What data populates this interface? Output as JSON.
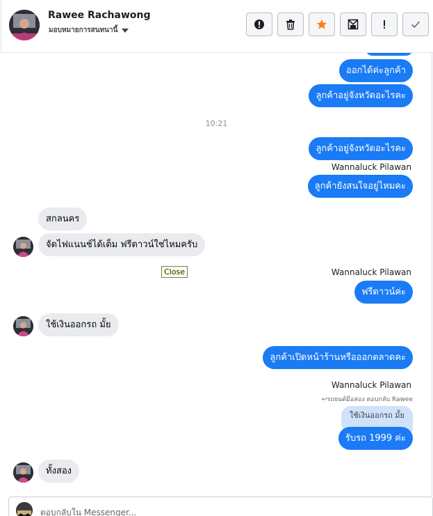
{
  "header": {
    "contact_name": "Rawee Rachawong",
    "page_label": "มอบหมายการสนทนานี้",
    "toolbar": [
      {
        "icon": "alert-circle-icon",
        "name": "mark-spam-button"
      },
      {
        "icon": "trash-icon",
        "name": "delete-button"
      },
      {
        "icon": "star-icon",
        "name": "star-button"
      },
      {
        "icon": "archive-icon",
        "name": "archive-button"
      },
      {
        "icon": "exclamation-icon",
        "name": "flag-button"
      },
      {
        "icon": "check-icon",
        "name": "done-button"
      }
    ],
    "star_color": "#f5821f"
  },
  "chat": {
    "outgoing_color": "#1a7bf4",
    "messages": {
      "m1": "ออกได้ค่ะลูกค้า",
      "m2": "ลูกค้าอยู่จังหวัดอะไรคะ",
      "time1": "10:21",
      "m3": "ลูกค้าอยู่จังหวัดอะไรคะ",
      "sender1": "Wannaluck Pilawan",
      "m4": "ลูกค้ายังสนใจอยู่ไหมคะ",
      "in1": "สกลนคร",
      "in2": "จัดไฟแนนช์ได้เต็ม ฟรีดาวน์ใช่ไหมครับ",
      "sender2": "Wannaluck Pilawan",
      "m5": "ฟรีดาวน์ค่ะ",
      "in3": "ใช้เงินออกรถ มั้ย",
      "m6": "ลูกค้าเปิดหน้าร้านหรือออกตลาดคะ",
      "sender3": "Wannaluck Pilawan",
      "reply_note": "รถยนต์มือสอง ตอบกลับ Rawee",
      "quoted": "ใช้เงินออกรถ มั้ย",
      "m7": "รับรถ 1999 ค่ะ",
      "in4": "ทั้งสอง"
    }
  },
  "tooltip": {
    "close": "Close"
  },
  "composer": {
    "placeholder": "ตอบกลับใน Messenger..."
  }
}
